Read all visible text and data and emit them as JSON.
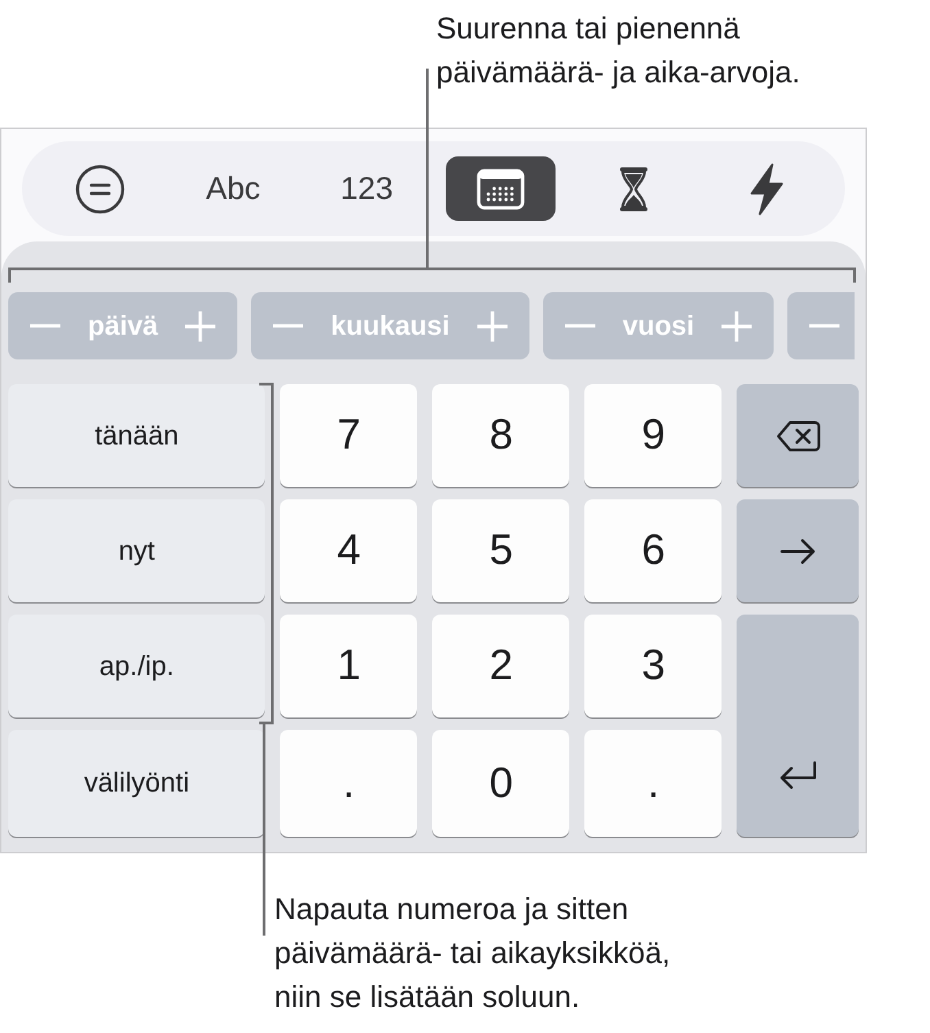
{
  "annotation_top": {
    "lines": [
      "Suurenna tai pienennä",
      "päivämäärä- ja aika-arvoja."
    ]
  },
  "keyboard": {
    "mode_tabs": [
      {
        "kind": "equals",
        "selected": false
      },
      {
        "kind": "label",
        "label": "Abc",
        "selected": false
      },
      {
        "kind": "label",
        "label": "123",
        "selected": false
      },
      {
        "kind": "calendar",
        "selected": true
      },
      {
        "kind": "hourglass",
        "selected": false
      },
      {
        "kind": "bolt",
        "selected": false
      }
    ],
    "unit_keys": [
      {
        "kind": "full",
        "label": "päivä"
      },
      {
        "kind": "full",
        "label": "kuukausi"
      },
      {
        "kind": "full",
        "label": "vuosi"
      },
      {
        "kind": "partial"
      }
    ],
    "shortcut_keys": [
      "tänään",
      "nyt",
      "ap./ip.",
      "välilyönti"
    ],
    "number_keys": [
      "7",
      "8",
      "9",
      "4",
      "5",
      "6",
      "1",
      "2",
      "3",
      ".",
      "0",
      "."
    ],
    "action_keys": [
      {
        "kind": "delete"
      },
      {
        "kind": "next"
      },
      {
        "kind": "return"
      }
    ]
  },
  "annotation_bottom": {
    "lines": [
      "Napauta numeroa ja sitten",
      "päivämäärä- tai aikayksikköä,",
      "niin se lisätään soluun."
    ]
  }
}
